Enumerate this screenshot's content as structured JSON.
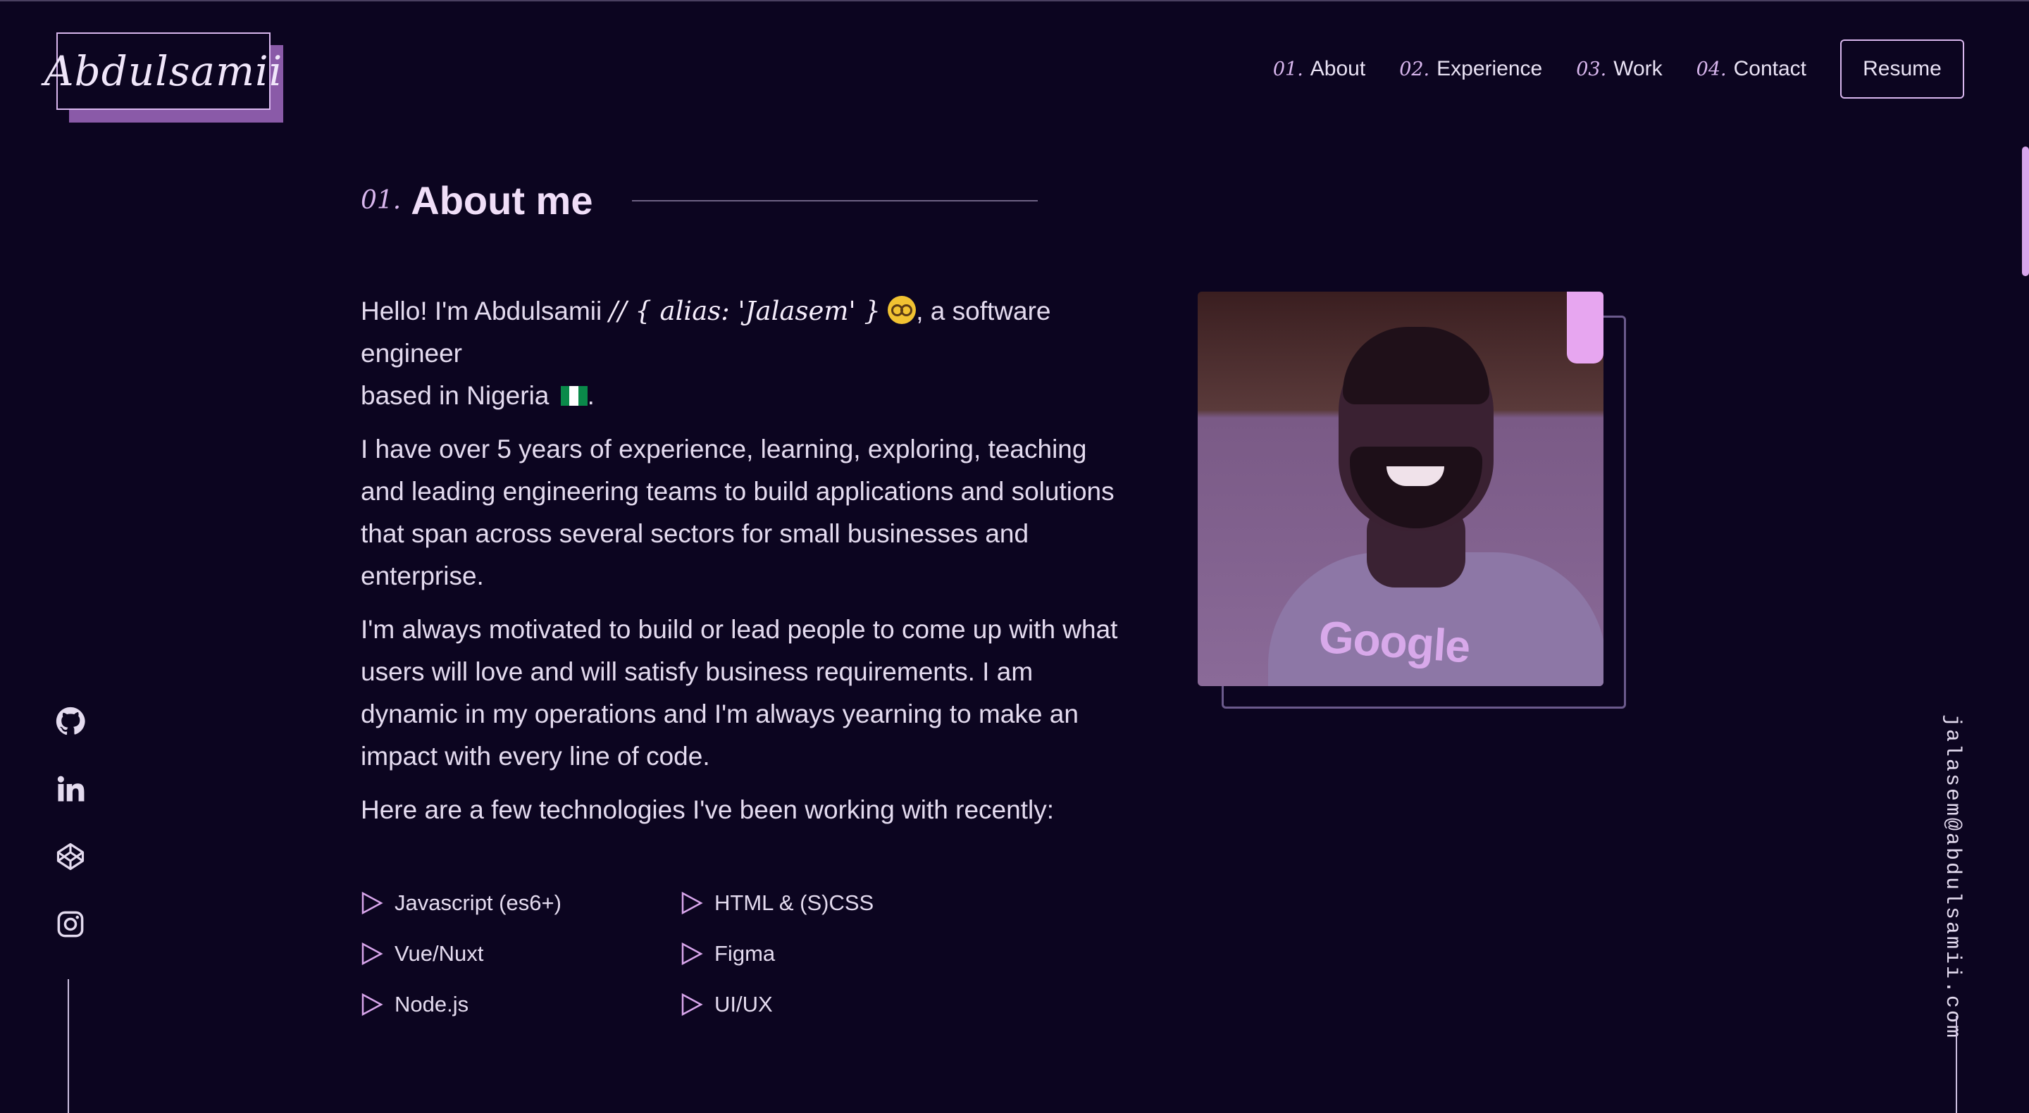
{
  "logo": {
    "text": "Abdulsamii"
  },
  "nav": {
    "items": [
      {
        "num": "01.",
        "label": "About"
      },
      {
        "num": "02.",
        "label": "Experience"
      },
      {
        "num": "03.",
        "label": "Work"
      },
      {
        "num": "04.",
        "label": "Contact"
      }
    ],
    "resume_label": "Resume"
  },
  "section": {
    "num": "01.",
    "title": "About me"
  },
  "about": {
    "intro_prefix": "Hello! I'm Abdulsamii",
    "alias": "// { alias: 'Jalasem' }",
    "intro_suffix": ", a software engineer",
    "intro_line2": "based in Nigeria",
    "p2": "I have over 5 years of experience, learning, exploring, teaching and leading engineering teams to build applications and solutions that span across several sectors for small businesses and enterprise.",
    "p3": "I'm always motivated to build or lead people to come up with what users will love and will satisfy business requirements. I am dynamic in my operations and I'm always yearning to make an impact with every line of code.",
    "p4": "Here are a few technologies I've been working with recently:"
  },
  "tech": [
    "Javascript (es6+)",
    "HTML & (S)CSS",
    "Vue/Nuxt",
    "Figma",
    "Node.js",
    "UI/UX"
  ],
  "photo": {
    "shirt_text": "Google"
  },
  "socials": [
    "github-icon",
    "linkedin-icon",
    "codepen-icon",
    "instagram-icon"
  ],
  "email": "jalasem@abdulsamii.com",
  "colors": {
    "background": "#0c0520",
    "accent": "#d9b7ee",
    "text": "#e4dbef"
  }
}
